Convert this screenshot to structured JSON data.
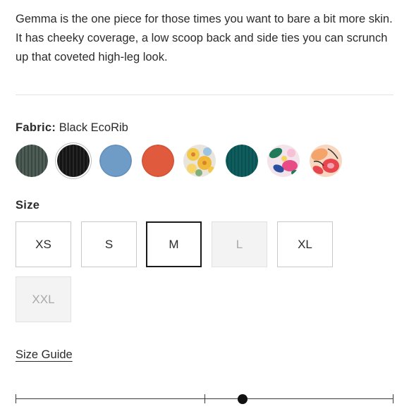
{
  "product": {
    "description": "Gemma is the one piece for those times you want to bare a bit more skin. It has cheeky coverage, a low scoop back and side ties you can scrunch up that coveted high-leg look."
  },
  "fabric": {
    "label": "Fabric:",
    "selected_value": "Black EcoRib",
    "swatches": [
      {
        "name": "sage-rib",
        "color": "#4f5d57"
      },
      {
        "name": "black-ecorib",
        "color": "#141414",
        "selected": true
      },
      {
        "name": "sky-blue",
        "color": "#6e9cc6"
      },
      {
        "name": "coral",
        "color": "#e05a3d"
      },
      {
        "name": "yellow-floral",
        "color": "#f2c94c"
      },
      {
        "name": "teal-rib",
        "color": "#0f5e5f"
      },
      {
        "name": "tropical-print",
        "color": "#e84b86"
      },
      {
        "name": "peach-floral",
        "color": "#f4a36b"
      }
    ]
  },
  "size": {
    "label": "Size",
    "options": [
      {
        "label": "XS",
        "state": "available"
      },
      {
        "label": "S",
        "state": "available"
      },
      {
        "label": "M",
        "state": "selected"
      },
      {
        "label": "L",
        "state": "unavailable"
      },
      {
        "label": "XL",
        "state": "available"
      },
      {
        "label": "XXL",
        "state": "unavailable"
      }
    ]
  },
  "size_guide": {
    "label": "Size Guide"
  },
  "fit_slider": {
    "stops": 3,
    "value_index": 1.2
  }
}
